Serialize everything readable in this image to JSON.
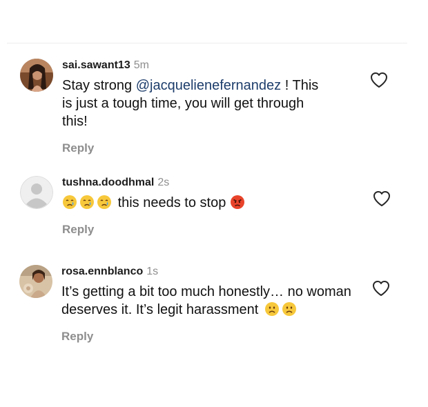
{
  "comments": [
    {
      "username": "sai.sawant13",
      "time": "5m",
      "text_before": "Stay strong ",
      "mention": "@jacquelienefernandez",
      "text_after_line1": " ! This",
      "text_line2": "is just a tough time, you will get through",
      "text_line3": "this!",
      "reply_label": "Reply"
    },
    {
      "username": "tushna.doodhmal",
      "time": "2s",
      "text": "this needs to stop",
      "emojis_before": [
        "crying-face",
        "crying-face",
        "crying-face"
      ],
      "emojis_after": [
        "angry-face"
      ],
      "reply_label": "Reply"
    },
    {
      "username": "rosa.ennblanco",
      "time": "1s",
      "text_line1": "It’s getting a bit too much honestly… no woman",
      "text_line2": "deserves it. It’s legit harassment",
      "emojis_after": [
        "frowning-face",
        "frowning-face"
      ],
      "reply_label": "Reply"
    }
  ]
}
